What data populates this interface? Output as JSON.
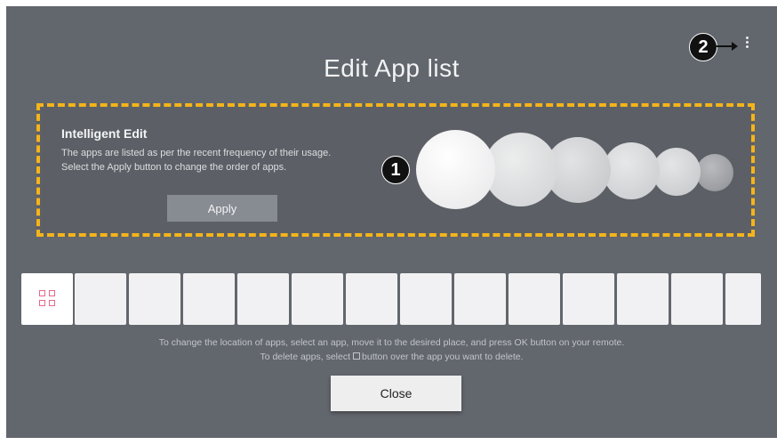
{
  "page": {
    "title": "Edit App list"
  },
  "markers": {
    "one": "1",
    "two": "2"
  },
  "intelligent_edit": {
    "title": "Intelligent Edit",
    "description_line1": "The apps are listed as per the recent frequency of their usage.",
    "description_line2": "Select the Apply button to change the order of apps.",
    "apply_label": "Apply"
  },
  "app_list": {
    "first_tile_icon": "app-grid-icon",
    "empty_tiles": 13
  },
  "hint": {
    "line1": "To change the location of apps, select an app, move it to the desired place, and press OK button on your remote.",
    "line2_before": "To delete apps, select",
    "line2_after": "button over the app you want to delete."
  },
  "close_label": "Close",
  "colors": {
    "background": "#62666d",
    "highlight_border": "#f4b41a",
    "grid_icon": "#e46a8a"
  },
  "icons": {
    "more": "more-vertical-icon",
    "delete": "delete-box-icon"
  }
}
